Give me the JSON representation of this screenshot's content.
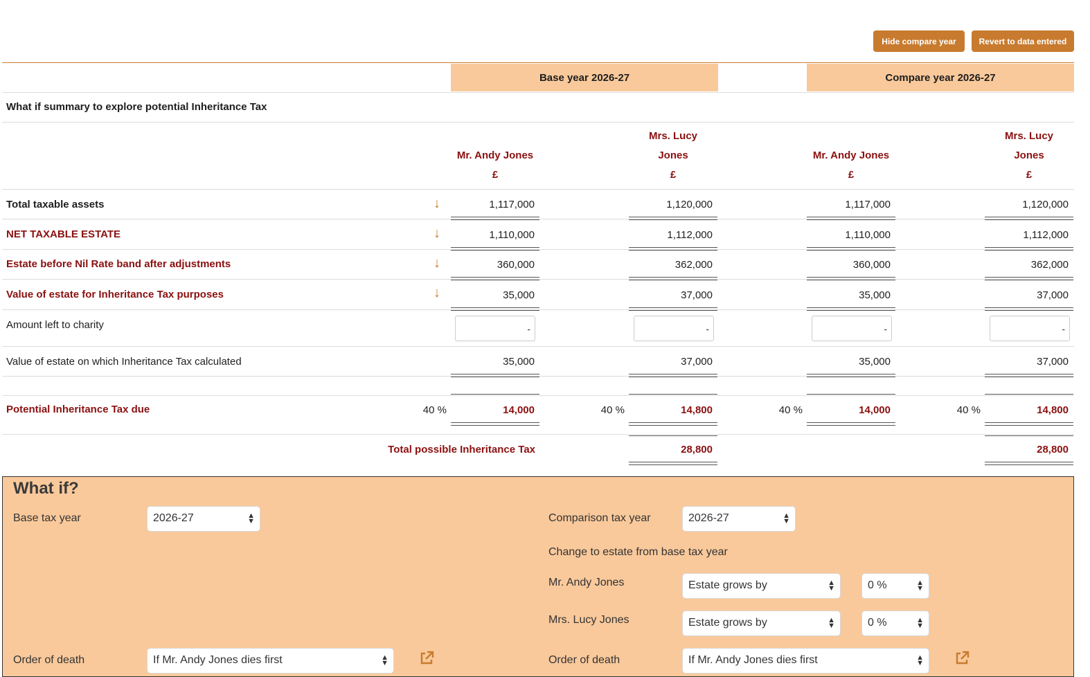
{
  "toolbar": {
    "hide_compare_label": "Hide compare year",
    "revert_label": "Revert to data entered"
  },
  "columns": {
    "base_header": "Base year 2026-27",
    "compare_header": "Compare year 2026-27"
  },
  "summary_title": "What if summary to explore potential Inheritance Tax",
  "people": {
    "p1": "Mr. Andy Jones",
    "p2_line1": "Mrs. Lucy",
    "p2_line2": "Jones",
    "currency": "£"
  },
  "rows": {
    "total_taxable_assets": {
      "label": "Total taxable assets",
      "values": [
        "1,117,000",
        "1,120,000",
        "1,117,000",
        "1,120,000"
      ]
    },
    "net_taxable_estate": {
      "label": "NET TAXABLE ESTATE",
      "values": [
        "1,110,000",
        "1,112,000",
        "1,110,000",
        "1,112,000"
      ]
    },
    "estate_before_nrb": {
      "label": "Estate before Nil Rate band after adjustments",
      "values": [
        "360,000",
        "362,000",
        "360,000",
        "362,000"
      ]
    },
    "value_for_iht": {
      "label": "Value of estate for Inheritance Tax purposes",
      "values": [
        "35,000",
        "37,000",
        "35,000",
        "37,000"
      ]
    },
    "charity": {
      "label": "Amount left to charity",
      "values": [
        "-",
        "-",
        "-",
        "-"
      ]
    },
    "iht_calculated": {
      "label": "Value of estate on which Inheritance Tax calculated",
      "values": [
        "35,000",
        "37,000",
        "35,000",
        "37,000"
      ]
    },
    "potential_iht": {
      "label": "Potential Inheritance Tax due",
      "rates": [
        "40 %",
        "40 %",
        "40 %",
        "40 %"
      ],
      "values": [
        "14,000",
        "14,800",
        "14,000",
        "14,800"
      ]
    },
    "total_possible": {
      "label": "Total possible Inheritance Tax",
      "values": [
        "28,800",
        "28,800"
      ]
    }
  },
  "whatif": {
    "title": "What if?",
    "base_tax_year_label": "Base tax year",
    "base_tax_year_value": "2026-27",
    "comparison_tax_year_label": "Comparison tax year",
    "comparison_tax_year_value": "2026-27",
    "change_label": "Change to estate from base tax year",
    "p1_label": "Mr. Andy Jones",
    "p1_change": "Estate grows by",
    "p1_pct": "0 %",
    "p2_label": "Mrs. Lucy Jones",
    "p2_change": "Estate grows by",
    "p2_pct": "0 %",
    "order_label": "Order of death",
    "base_order_value": "If Mr. Andy Jones dies first",
    "compare_order_value": "If Mr. Andy Jones dies first"
  },
  "colors": {
    "accent": "#c87b2e",
    "header_bg": "#f9c99b",
    "emphasis_red": "#8b1010"
  },
  "icons": {
    "row_expand": "arrow-down-icon",
    "select": "chevron-updown-icon",
    "popout": "external-link-icon"
  }
}
